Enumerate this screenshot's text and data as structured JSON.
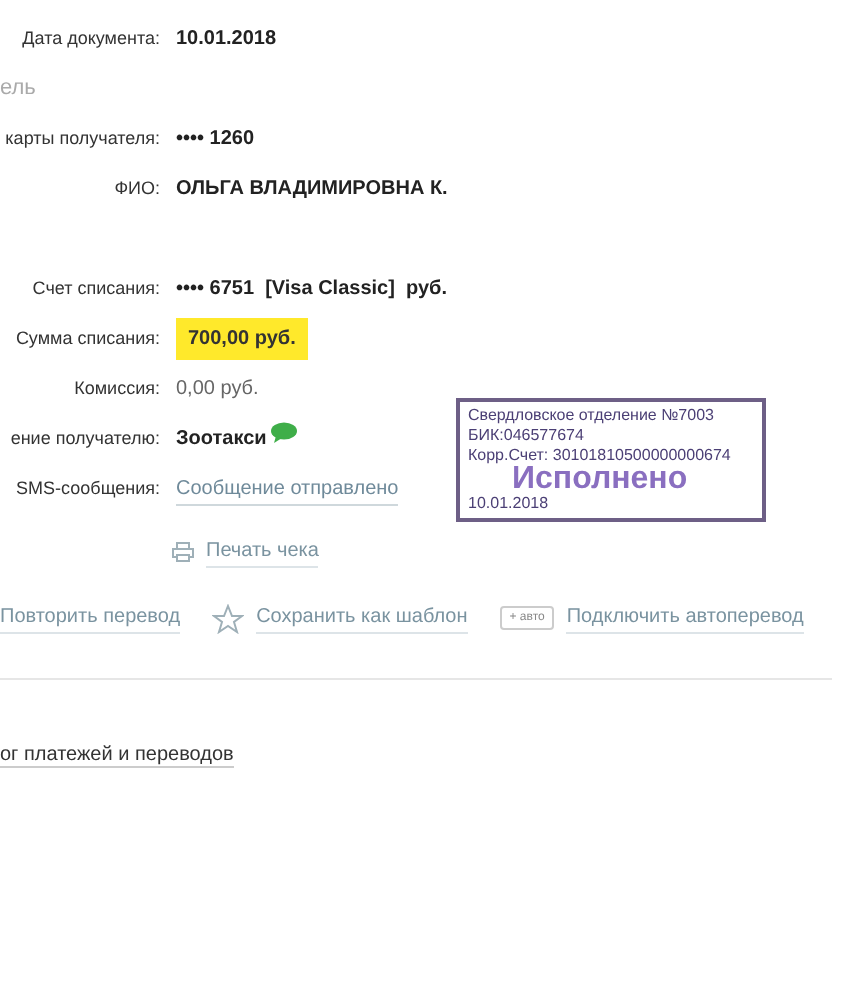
{
  "document_date": {
    "label": "Дата документа:",
    "value": "10.01.2018"
  },
  "section_heading": "ель",
  "recipient": [
    {
      "kind": "text",
      "label": "карты получателя:",
      "value": "•••• 1260",
      "bold": true
    },
    {
      "kind": "text",
      "label": "ФИО:",
      "value": "ОЛЬГА ВЛАДИМИРОВНА К.",
      "bold": true
    }
  ],
  "payment": [
    {
      "kind": "text",
      "label": "Счет списания:",
      "value": "•••• 6751  [Visa Classic]  руб.",
      "bold": true
    },
    {
      "kind": "highlight",
      "label": "Сумма списания:",
      "value": "700,00  руб.",
      "bold": true
    },
    {
      "kind": "text",
      "label": "Комиссия:",
      "value": "0,00 руб.",
      "bold": false
    },
    {
      "kind": "sms",
      "label": "ение получателю:",
      "value": "Зоотакси",
      "bold": true
    },
    {
      "kind": "link",
      "label": "SMS-сообщения:",
      "value": "Сообщение отправлено",
      "bold": false
    }
  ],
  "print_link": "Печать чека",
  "actions": [
    {
      "kind": "repeat",
      "label": "Повторить перевод"
    },
    {
      "kind": "star",
      "label": "Сохранить как шаблон"
    },
    {
      "kind": "auto",
      "badge": "+ авто",
      "label": "Подключить автоперевод"
    }
  ],
  "stamp": {
    "lines": [
      "Свердловское отделение №7003",
      "БИК:046577674",
      "Корр.Счет: 30101810500000000674"
    ],
    "status": "Исполнено",
    "date": "10.01.2018"
  },
  "history_link": "ог платежей и переводов"
}
